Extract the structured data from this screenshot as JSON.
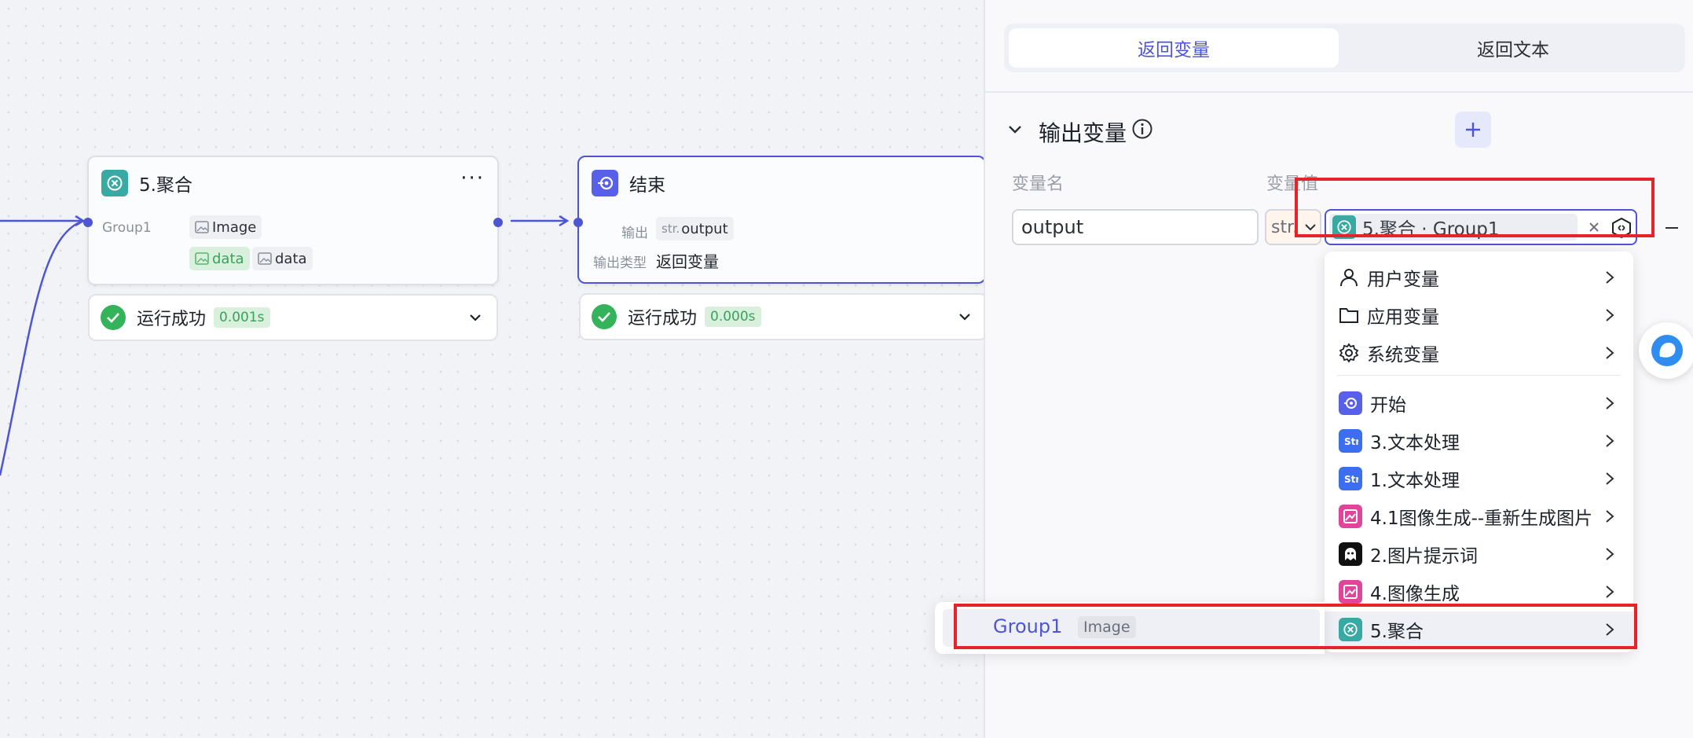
{
  "canvas": {
    "aggregate_node": {
      "title": "5.聚合",
      "group_label": "Group1",
      "inputs": [
        {
          "label": "Image",
          "style": "plain"
        },
        {
          "label": "data",
          "style": "green"
        },
        {
          "label": "data",
          "style": "plain"
        }
      ],
      "status": {
        "text": "运行成功",
        "time": "0.001s"
      }
    },
    "end_node": {
      "title": "结束",
      "output_label": "输出",
      "output_type_prefix": "str.",
      "output_value": "output",
      "output_kind_label": "输出类型",
      "output_kind_value": "返回变量",
      "status": {
        "text": "运行成功",
        "time": "0.000s"
      }
    }
  },
  "panel": {
    "tabs": [
      {
        "label": "返回变量",
        "active": true
      },
      {
        "label": "返回文本",
        "active": false
      }
    ],
    "section_title": "输出变量",
    "columns": {
      "name": "变量名",
      "value": "变量值"
    },
    "row": {
      "name_value": "output",
      "type_value": "str.",
      "ref_value": "5.聚合 · Group1"
    }
  },
  "dropdown": {
    "system_items": [
      {
        "label": "用户变量",
        "icon": "person-icon"
      },
      {
        "label": "应用变量",
        "icon": "folder-icon"
      },
      {
        "label": "系统变量",
        "icon": "gear-icon"
      }
    ],
    "node_items": [
      {
        "label": "开始",
        "icon": "start-icon",
        "color": "#5860ea"
      },
      {
        "label": "3.文本处理",
        "icon": "text-process-icon",
        "color": "#3c6ff0"
      },
      {
        "label": "1.文本处理",
        "icon": "text-process-icon",
        "color": "#3c6ff0"
      },
      {
        "label": "4.1图像生成--重新生成图片",
        "icon": "image-gen-icon",
        "color": "#e0459c"
      },
      {
        "label": "2.图片提示词",
        "icon": "ghost-icon",
        "color": "#111111"
      },
      {
        "label": "4.图像生成",
        "icon": "image-gen-icon",
        "color": "#e0459c"
      },
      {
        "label": "5.聚合",
        "icon": "aggregate-icon",
        "color": "#38a9a3"
      }
    ]
  },
  "subpanel": {
    "name": "Group1",
    "type": "Image"
  },
  "colors": {
    "accent": "#4e55d4",
    "success": "#34b35a",
    "highlight": "#e5232b"
  }
}
